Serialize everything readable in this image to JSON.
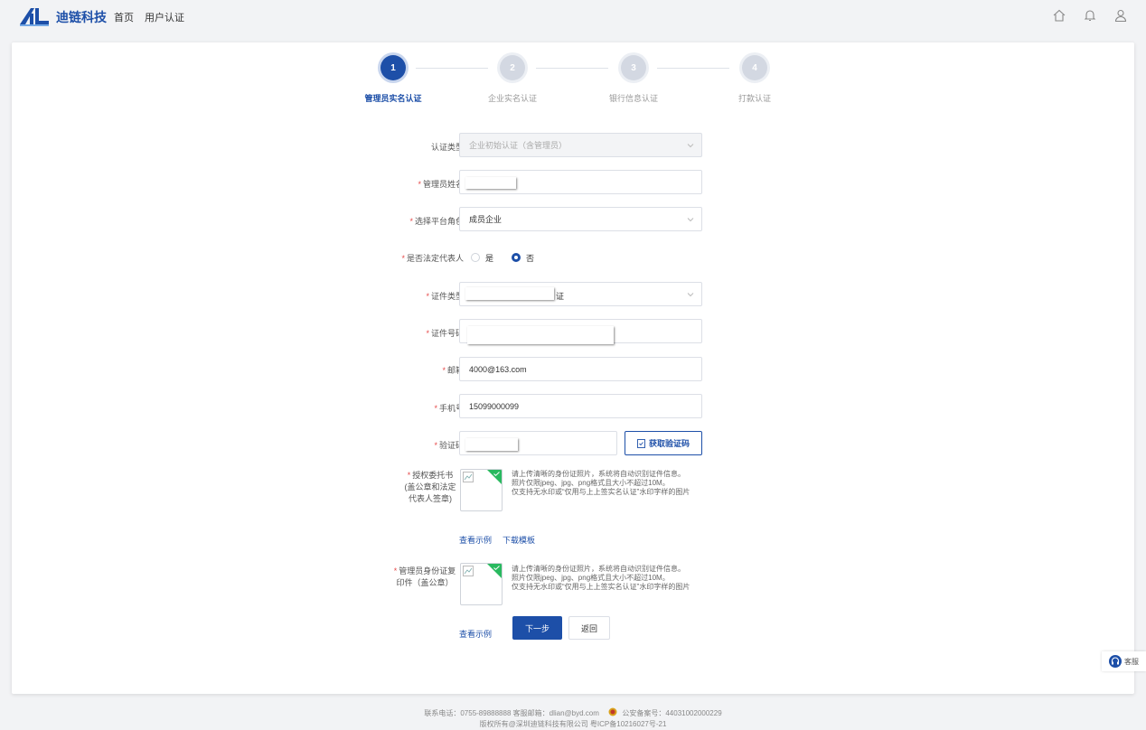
{
  "header": {
    "brand": "迪链科技",
    "nav": [
      "首页",
      "用户认证"
    ]
  },
  "steps": [
    {
      "num": "1",
      "label": "管理员实名认证",
      "active": true
    },
    {
      "num": "2",
      "label": "企业实名认证",
      "active": false
    },
    {
      "num": "3",
      "label": "银行信息认证",
      "active": false
    },
    {
      "num": "4",
      "label": "打款认证",
      "active": false
    }
  ],
  "form": {
    "cert_type": {
      "label": "认证类型",
      "value": "企业初始认证（含管理员）"
    },
    "admin_name": {
      "label": "管理员姓名",
      "value": ""
    },
    "platform_role": {
      "label": "选择平台角色",
      "value": "成员企业"
    },
    "legal_rep": {
      "label": "是否法定代表人",
      "options": [
        "是",
        "否"
      ],
      "selected": "否"
    },
    "id_type": {
      "label": "证件类型",
      "value_suffix": "证"
    },
    "id_number": {
      "label": "证件号码",
      "value": ""
    },
    "email": {
      "label": "邮箱",
      "value": "4000@163.com"
    },
    "phone": {
      "label": "手机号",
      "value": "15099000099"
    },
    "code": {
      "label": "验证码",
      "button": "获取验证码"
    },
    "authorization": {
      "label_lines": [
        "授权委托书",
        "(盖公章和法定",
        "代表人签章)"
      ],
      "hint": [
        "请上传清晰的身份证照片，系统将自动识别证件信息。",
        "照片仅限jpeg、jpg、png格式且大小不超过10M。",
        "仅支持无水印或“仅用与上上签实名认证”水印字样的图片"
      ],
      "links": [
        "查看示例",
        "下载模板"
      ]
    },
    "id_copy": {
      "label_lines": [
        "管理员身份证复",
        "印件（盖公章）"
      ],
      "hint": [
        "请上传清晰的身份证照片，系统将自动识别证件信息。",
        "照片仅限jpeg、jpg、png格式且大小不超过10M。",
        "仅支持无水印或“仅用与上上签实名认证”水印字样的图片"
      ],
      "links": [
        "查看示例"
      ]
    }
  },
  "buttons": {
    "next": "下一步",
    "back": "返回"
  },
  "service": "客服",
  "footer": {
    "line1_a": "联系电话：0755-89888888   客服邮箱：dlian@byd.com",
    "line1_b": "公安备案号：44031002000229",
    "line2": "版权所有@深圳迪链科技有限公司   粤ICP备10216027号-21"
  },
  "colors": {
    "primary": "#1d4fa8",
    "required": "#e64b4b",
    "success": "#29b95f"
  }
}
